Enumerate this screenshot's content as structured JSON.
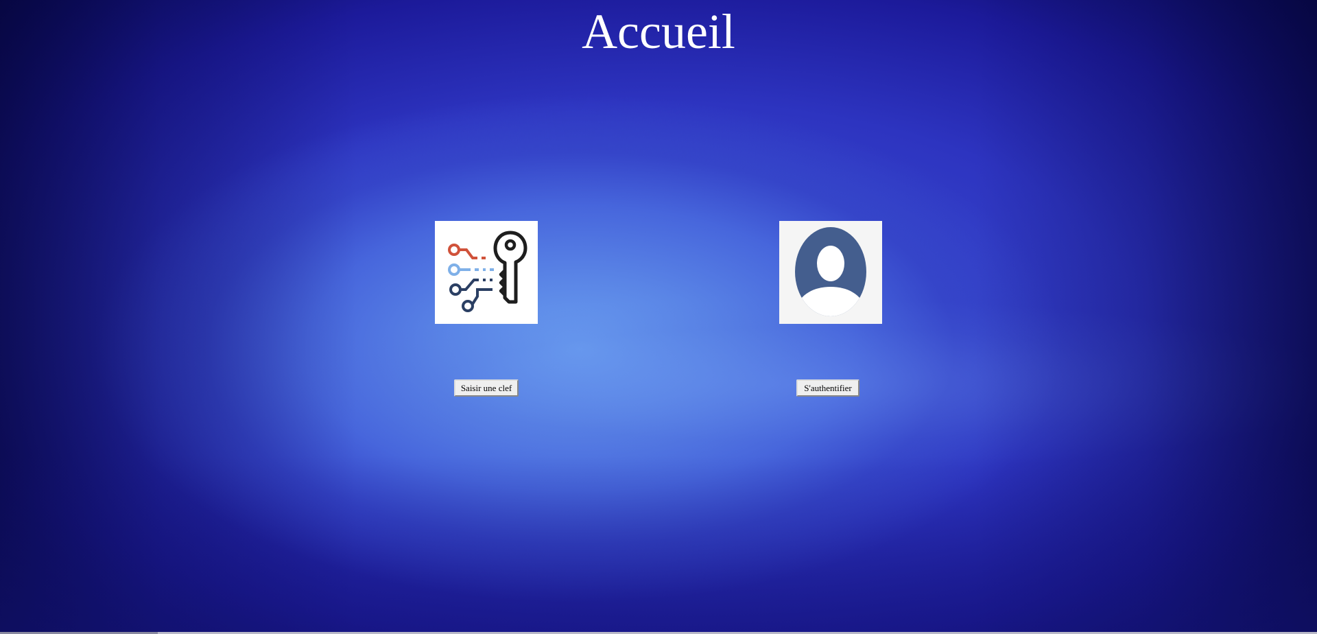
{
  "header": {
    "title": "Accueil"
  },
  "cards": {
    "key": {
      "icon": "key-circuit-icon",
      "button_label": "Saisir une clef"
    },
    "auth": {
      "icon": "user-avatar-icon",
      "button_label": "S'authentifier"
    }
  },
  "colors": {
    "title_text": "#ffffff",
    "background_center": "#6a9ef0",
    "background_edge": "#05053a",
    "key_red": "#d0523a",
    "key_light_blue": "#7fb0e8",
    "key_dark_blue": "#2b3f63",
    "avatar_blue": "#445e8e"
  }
}
